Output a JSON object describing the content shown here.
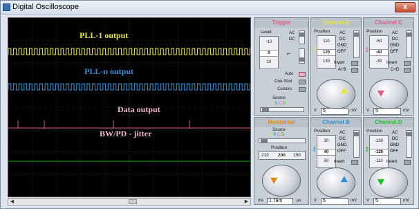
{
  "window": {
    "title": "Digital Oscilloscope",
    "close_glyph": "x"
  },
  "screen": {
    "labels": {
      "pll1": "PLL-1 output",
      "plln": "PLL-n output",
      "data": "Data output",
      "bw": "BW/PD - jitter"
    },
    "colors": {
      "pll1": "#e8e832",
      "plln": "#2f8fd6",
      "data": "#e05a87",
      "bw": "#19c219",
      "grid": "#1c6b2a",
      "bg": "#000000"
    }
  },
  "scrollbar": {
    "left": "◀",
    "right": "▶"
  },
  "trigger": {
    "title": "Trigger",
    "title_color": "#e05a87",
    "level_label": "Level",
    "level_values": [
      "-10",
      "0",
      "10"
    ],
    "coupling": [
      "AC",
      "DC"
    ],
    "auto_label": "Auto",
    "one_shot_label": "One-Shot",
    "cursors_label": "Cursors",
    "source_label": "Source",
    "source_letters": [
      "A",
      "B",
      "C",
      "D"
    ],
    "source_colors": [
      "#e8e832",
      "#2f8fd6",
      "#e05a87",
      "#19c219"
    ]
  },
  "horizontal": {
    "title": "Horizontal",
    "title_color": "#e08a10",
    "source_label": "Source",
    "source_letters": [
      "A",
      "B",
      "C",
      "D"
    ],
    "position_label": "Position",
    "position_values": [
      "210",
      "200",
      "190"
    ],
    "units": [
      "ms",
      "μs"
    ],
    "scale_value": "1.78m",
    "dial_marks": [
      "200",
      "50",
      "20",
      "10",
      "5",
      "2",
      "1",
      "0.5",
      "0.2"
    ],
    "dial_color": "#e08a10"
  },
  "channels": [
    {
      "name": "Channel A",
      "color": "#e8e832",
      "position_values": [
        "110",
        "120",
        "130"
      ],
      "coupling": [
        "AC",
        "DC",
        "GND",
        "OFF"
      ],
      "invert_label": "Invert",
      "combo_label": "A+B",
      "volts": "5",
      "units": [
        "V",
        "mV"
      ]
    },
    {
      "name": "Channel C",
      "color": "#e05a87",
      "position_values": [
        "-50",
        "-40",
        "-30"
      ],
      "coupling": [
        "AC",
        "DC",
        "GND",
        "OFF"
      ],
      "invert_label": "Invert",
      "combo_label": "C+D",
      "volts": "5",
      "units": [
        "V",
        "mV"
      ]
    },
    {
      "name": "Channel B",
      "color": "#2f8fd6",
      "position_values": [
        "30",
        "40",
        "50"
      ],
      "coupling": [
        "AC",
        "DC",
        "GND",
        "OFF"
      ],
      "invert_label": "Invert",
      "combo_label": "",
      "volts": "5",
      "units": [
        "V",
        "mV"
      ]
    },
    {
      "name": "Channel D",
      "color": "#19c219",
      "position_values": [
        "-130",
        "-120",
        "-110"
      ],
      "coupling": [
        "AC",
        "DC",
        "GND",
        "OFF"
      ],
      "invert_label": "Invert",
      "combo_label": "",
      "volts": "5",
      "units": [
        "V",
        "mV"
      ]
    }
  ],
  "channel_position_label": "Position",
  "channel_dial_marks": [
    "2",
    "1",
    "0.5",
    "0.2",
    "0.1",
    "50",
    "20",
    "10",
    "5",
    "2",
    "1",
    "0.5",
    "0.2",
    "0.1",
    "50",
    "20"
  ]
}
